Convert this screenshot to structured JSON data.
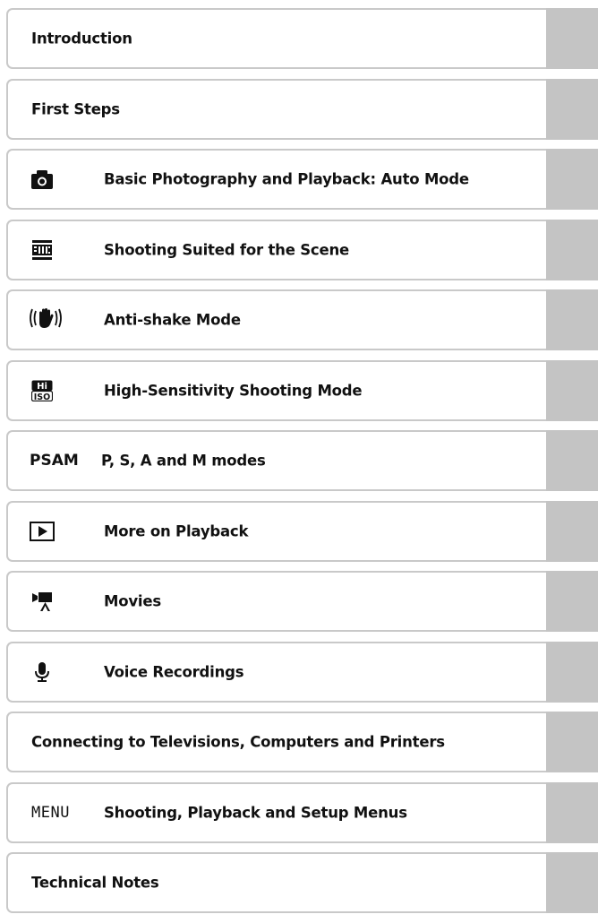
{
  "toc": {
    "items": [
      {
        "label": "Introduction"
      },
      {
        "label": "First Steps"
      },
      {
        "label": "Basic Photography and Playback: Auto Mode",
        "icon": "camera-icon"
      },
      {
        "label": "Shooting Suited for the Scene",
        "icon": "scene-icon"
      },
      {
        "label": "Anti-shake Mode",
        "icon": "anti-shake-icon"
      },
      {
        "label": "High-Sensitivity Shooting Mode",
        "icon": "hi-iso-icon"
      },
      {
        "label": "P, S, A and M modes",
        "icon_text": "PSAM"
      },
      {
        "label": "More on Playback",
        "icon": "playback-icon"
      },
      {
        "label": "Movies",
        "icon": "movie-camera-icon"
      },
      {
        "label": "Voice Recordings",
        "icon": "microphone-icon"
      },
      {
        "label": "Connecting to Televisions, Computers and Printers"
      },
      {
        "label": "Shooting, Playback and Setup Menus",
        "icon_text": "MENU"
      },
      {
        "label": "Technical Notes"
      }
    ]
  }
}
